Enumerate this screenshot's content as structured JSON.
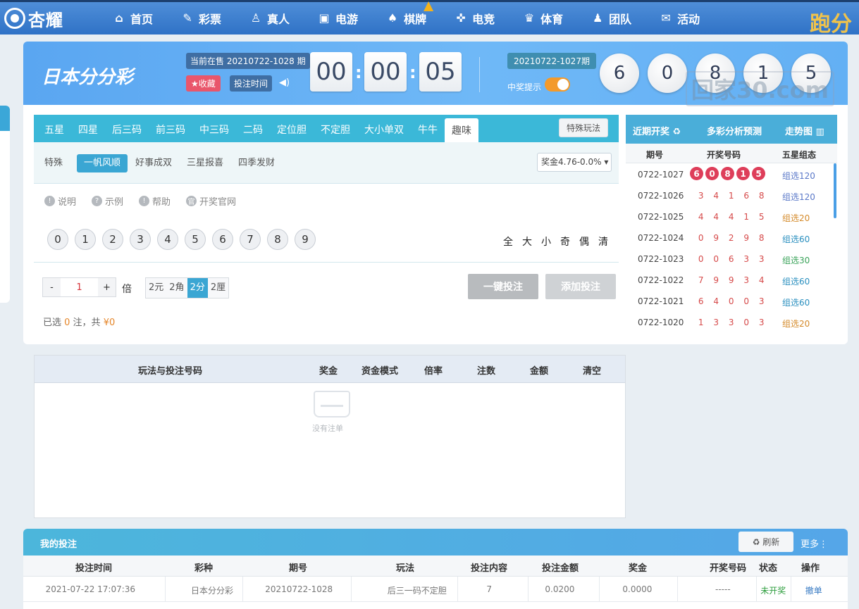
{
  "nav": {
    "logo": "杏耀",
    "items": [
      {
        "label": "首页",
        "icon": "home-icon",
        "glyph": "⌂"
      },
      {
        "label": "彩票",
        "icon": "ticket-icon",
        "glyph": "✎"
      },
      {
        "label": "真人",
        "icon": "person-icon",
        "glyph": "♙"
      },
      {
        "label": "电游",
        "icon": "slot-icon",
        "glyph": "▣"
      },
      {
        "label": "棋牌",
        "icon": "cards-icon",
        "glyph": "♠"
      },
      {
        "label": "电竞",
        "icon": "gamepad-icon",
        "glyph": "✜"
      },
      {
        "label": "体育",
        "icon": "trophy-icon",
        "glyph": "♛"
      },
      {
        "label": "团队",
        "icon": "team-icon",
        "glyph": "♟"
      },
      {
        "label": "活动",
        "icon": "gift-icon",
        "glyph": "✉"
      }
    ],
    "right_text": "跑分"
  },
  "header": {
    "brand": "日本分分彩",
    "current_issue": "当前在售 20210722-1028 期",
    "fav_label": "★收藏",
    "bet_time_label": "投注时间",
    "countdown": [
      "00",
      "00",
      "05"
    ],
    "last_issue": "20210722-1027期",
    "win_tip": "中奖提示",
    "balls": [
      "6",
      "0",
      "8",
      "1",
      "5"
    ],
    "watermark": "回家30.com"
  },
  "play": {
    "tabs": [
      "五星",
      "四星",
      "后三码",
      "前三码",
      "中三码",
      "二码",
      "定位胆",
      "不定胆",
      "大小单双",
      "牛牛",
      "趣味"
    ],
    "active_tab": "趣味",
    "special_label": "特殊玩法",
    "subtabs": [
      "特殊",
      "一帆风顺",
      "好事成双",
      "三星报喜",
      "四季发财"
    ],
    "prize": "奖金4.76-0.0%",
    "help": [
      "说明",
      "示例",
      "帮助",
      "开奖官网"
    ],
    "numbers": [
      "0",
      "1",
      "2",
      "3",
      "4",
      "5",
      "6",
      "7",
      "8",
      "9"
    ],
    "quick": [
      "全",
      "大",
      "小",
      "奇",
      "偶",
      "清"
    ],
    "multiplier": "1",
    "bei": "倍",
    "units": [
      "2元",
      "2角",
      "2分",
      "2厘"
    ],
    "active_unit": "2分",
    "bet_now": "一键投注",
    "add_bet": "添加投注",
    "summary_prefix": "已选 ",
    "summary_count": "0",
    "summary_mid": " 注，共 ",
    "summary_amount": "¥0"
  },
  "history": {
    "tabs": [
      "近期开奖 ♻",
      "多彩分析预测",
      "走势图 ▥"
    ],
    "cols": [
      "期号",
      "开奖号码",
      "五星组态"
    ],
    "rows": [
      {
        "issue": "0722-1027",
        "code": [
          "6",
          "0",
          "8",
          "1",
          "5"
        ],
        "group": "组选120",
        "color": "#5a78c8"
      },
      {
        "issue": "0722-1026",
        "code": [
          "3",
          "4",
          "1",
          "6",
          "8"
        ],
        "group": "组选120",
        "color": "#5a78c8"
      },
      {
        "issue": "0722-1025",
        "code": [
          "4",
          "4",
          "4",
          "1",
          "5"
        ],
        "group": "组选20",
        "color": "#d48a2a"
      },
      {
        "issue": "0722-1024",
        "code": [
          "0",
          "9",
          "2",
          "9",
          "8"
        ],
        "group": "组选60",
        "color": "#2a8fbf"
      },
      {
        "issue": "0722-1023",
        "code": [
          "0",
          "0",
          "6",
          "3",
          "3"
        ],
        "group": "组选30",
        "color": "#3aa35a"
      },
      {
        "issue": "0722-1022",
        "code": [
          "7",
          "9",
          "9",
          "3",
          "4"
        ],
        "group": "组选60",
        "color": "#2a8fbf"
      },
      {
        "issue": "0722-1021",
        "code": [
          "6",
          "4",
          "0",
          "0",
          "3"
        ],
        "group": "组选60",
        "color": "#2a8fbf"
      },
      {
        "issue": "0722-1020",
        "code": [
          "1",
          "3",
          "3",
          "0",
          "3"
        ],
        "group": "组选20",
        "color": "#d48a2a"
      }
    ]
  },
  "betlist": {
    "cols": [
      "玩法与投注号码",
      "奖金",
      "资金模式",
      "倍率",
      "注数",
      "金额",
      "清空"
    ],
    "empty": "没有注单"
  },
  "mybets": {
    "title": "我的投注",
    "refresh": "♻ 刷新",
    "more": "更多⋮",
    "cols": [
      "投注时间",
      "彩种",
      "期号",
      "玩法",
      "投注内容",
      "投注金额",
      "奖金",
      "开奖号码",
      "状态",
      "操作"
    ],
    "row": [
      "2021-07-22 17:07:36",
      "日本分分彩",
      "20210722-1028",
      "后三一码不定胆",
      "7",
      "0.0200",
      "0.0000",
      "-----",
      "未开奖",
      "撤单"
    ],
    "status_color": "#2e9e3e",
    "action_color": "#3a7cc4"
  }
}
